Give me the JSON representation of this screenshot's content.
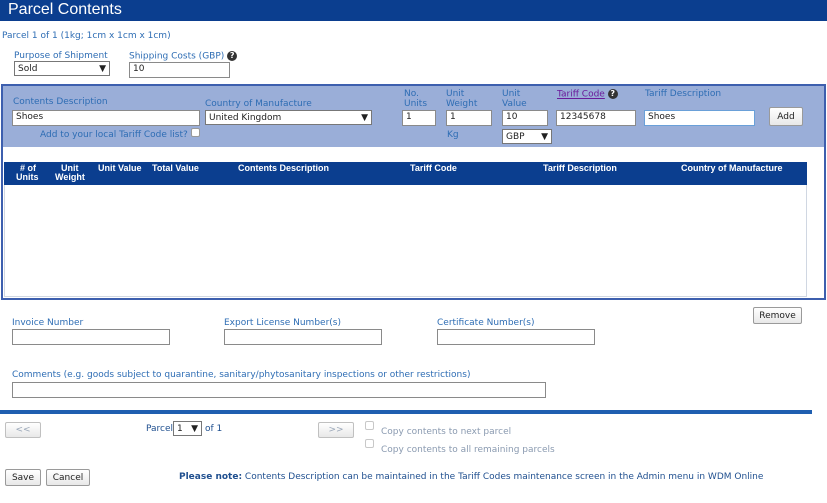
{
  "title": "Parcel Contents",
  "parcel_info": "Parcel 1 of 1 (1kg; 1cm x 1cm x 1cm)",
  "purpose": {
    "label": "Purpose of Shipment",
    "value": "Sold"
  },
  "shipping": {
    "label": "Shipping Costs (GBP)",
    "value": "10"
  },
  "entry": {
    "contents_description_label": "Contents Description",
    "contents_description_value": "Shoes",
    "add_tariff_label": "Add to your local Tariff Code list?",
    "country_label": "Country of Manufacture",
    "country_value": "United Kingdom",
    "no_units_label1": "No.",
    "no_units_label2": "Units",
    "no_units_value": "1",
    "unit_weight_label1": "Unit",
    "unit_weight_label2": "Weight",
    "unit_weight_value": "1",
    "unit_weight_unit": "Kg",
    "unit_value_label1": "Unit",
    "unit_value_label2": "Value",
    "unit_value_value": "10",
    "currency_value": "GBP",
    "tariff_code_label": "Tariff Code",
    "tariff_code_value": "12345678",
    "tariff_desc_label": "Tariff Description",
    "tariff_desc_value": "Shoes",
    "add_button": "Add"
  },
  "table_headers": {
    "units1": "# of",
    "units2": "Units",
    "weight1": "Unit",
    "weight2": "Weight",
    "unit_value": "Unit Value",
    "total_value": "Total Value",
    "contents_description": "Contents Description",
    "tariff_code": "Tariff Code",
    "tariff_description": "Tariff Description",
    "country": "Country of Manufacture"
  },
  "remove_button": "Remove",
  "invoice_label": "Invoice Number",
  "export_label": "Export License Number(s)",
  "certificate_label": "Certificate Number(s)",
  "comments_label": "Comments (e.g. goods subject to quarantine, sanitary/phytosanitary inspections or other restrictions)",
  "nav": {
    "prev": "<<",
    "parcel_label": "Parcel",
    "parcel_value": "1",
    "of_label": "of 1",
    "next": ">>",
    "copy_next": "Copy contents to next parcel",
    "copy_all": "Copy contents to all remaining parcels"
  },
  "save_button": "Save",
  "cancel_button": "Cancel",
  "note_bold": "Please note:",
  "note_text": " Contents Description can be maintained in the Tariff Codes maintenance screen in the Admin menu in WDM Online",
  "colors": {
    "brand": "#0b3e8f",
    "entry_header": "#9aaed8",
    "label": "#2e6db4"
  }
}
